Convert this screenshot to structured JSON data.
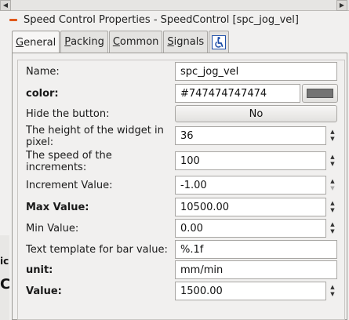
{
  "window": {
    "title": "Speed Control Properties - SpeedControl [spc_jog_vel]",
    "accent_color": "#e0581a"
  },
  "scrollbar": {
    "left_icon": "arrow-left-icon",
    "right_icon": "arrow-right-icon"
  },
  "background_fragments": [
    "ic",
    "C"
  ],
  "tabs": [
    {
      "label": "General",
      "underline": "G",
      "rest": "eneral",
      "active": true
    },
    {
      "label": "Packing",
      "underline": "P",
      "rest": "acking",
      "active": false
    },
    {
      "label": "Common",
      "underline": "C",
      "rest": "ommon",
      "active": false
    },
    {
      "label": "Signals",
      "underline": "S",
      "rest": "ignals",
      "active": false
    },
    {
      "label": "",
      "icon": "accessibility-icon",
      "active": false
    }
  ],
  "form": {
    "name": {
      "label": "Name:",
      "value": "spc_jog_vel"
    },
    "color": {
      "label": "color:",
      "value": "#747474747474",
      "swatch": "#747474"
    },
    "hide_button": {
      "label": "Hide the button:",
      "value": "No"
    },
    "height": {
      "label_line1": "The height of the widget in",
      "label_line2": "pixel:",
      "value": "36"
    },
    "speed": {
      "label_line1": "The speed of the",
      "label_line2": "increments:",
      "value": "100"
    },
    "increment": {
      "label": "Increment Value:",
      "value": "-1.00"
    },
    "max": {
      "label": "Max Value:",
      "value": "10500.00"
    },
    "min": {
      "label": "Min Value:",
      "value": "0.00"
    },
    "template": {
      "label": "Text template for bar value:",
      "value": "%.1f"
    },
    "unit": {
      "label": "unit:",
      "value": "mm/min"
    },
    "value": {
      "label": "Value:",
      "value": "1500.00"
    }
  }
}
